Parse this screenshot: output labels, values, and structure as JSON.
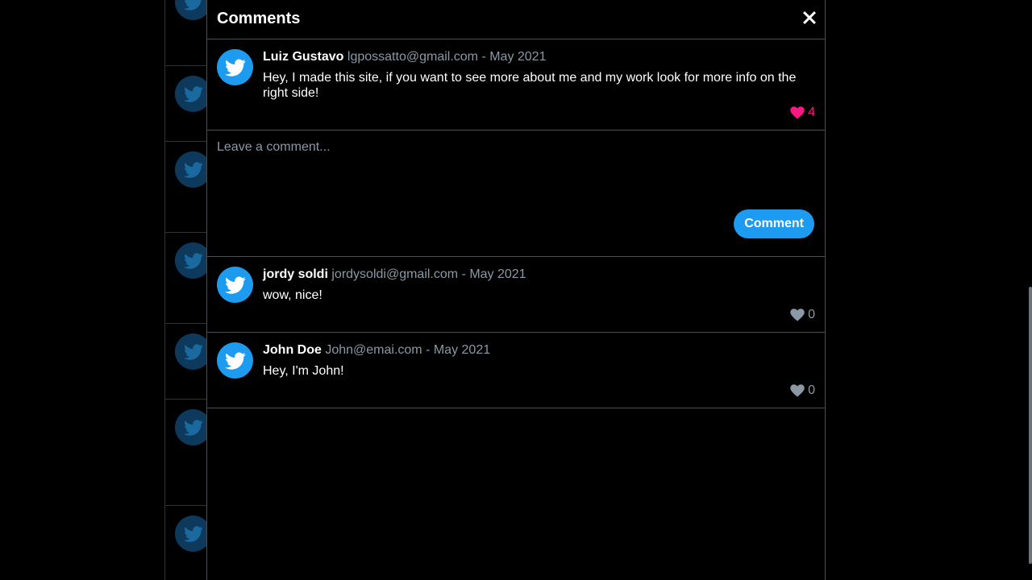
{
  "modal": {
    "title": "Comments"
  },
  "colors": {
    "accent": "#1d9bf0",
    "like_active": "#f91880",
    "like_inactive": "#8b98a5",
    "muted_text": "#8b98a5",
    "border": "#4a4f53"
  },
  "post": {
    "name": "Luiz Gustavo",
    "meta": "lgpossatto@gmail.com - May 2021",
    "text": "Hey, I made this site, if you want to see more about me and my work look for more info on the right side!",
    "likes": "4",
    "liked": true,
    "avatar_icon": "twitter-bird-icon"
  },
  "composer": {
    "placeholder": "Leave a comment...",
    "button_label": "Comment"
  },
  "comments": [
    {
      "name": "jordy soldi",
      "meta": "jordysoldi@gmail.com - May 2021",
      "text": "wow, nice!",
      "likes": "0",
      "liked": false,
      "avatar_icon": "twitter-bird-icon"
    },
    {
      "name": "John Doe",
      "meta": "John@emai.com - May 2021",
      "text": "Hey, I'm John!",
      "likes": "0",
      "liked": false,
      "avatar_icon": "twitter-bird-icon"
    }
  ]
}
